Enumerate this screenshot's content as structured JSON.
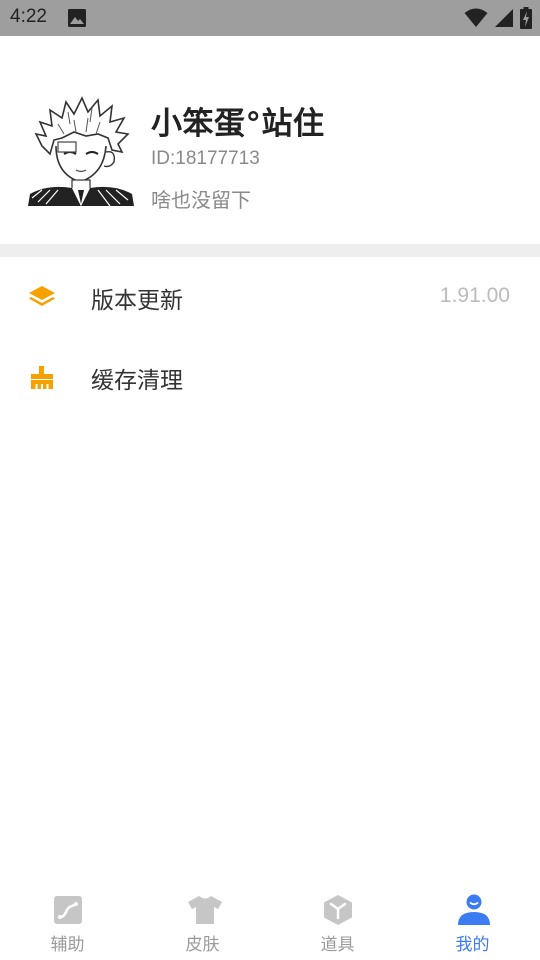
{
  "status_bar": {
    "time": "4:22",
    "icons": [
      "image-icon",
      "wifi-icon",
      "signal-icon",
      "battery-charging-icon"
    ]
  },
  "profile": {
    "nickname": "小笨蛋°站住",
    "id_text": "ID:18177713",
    "bio": "啥也没留下"
  },
  "menu": {
    "items": [
      {
        "label": "版本更新",
        "value": "1.91.00",
        "icon": "layers-icon"
      },
      {
        "label": "缓存清理",
        "value": "",
        "icon": "broom-icon"
      }
    ]
  },
  "tabbar": {
    "tabs": [
      {
        "label": "辅助",
        "icon": "assist-icon",
        "active": false
      },
      {
        "label": "皮肤",
        "icon": "tshirt-icon",
        "active": false
      },
      {
        "label": "道具",
        "icon": "box-icon",
        "active": false
      },
      {
        "label": "我的",
        "icon": "user-icon",
        "active": true
      }
    ]
  },
  "colors": {
    "accent": "#3b7cf2",
    "menu_icon": "#f5a100",
    "tab_inactive": "#c6c6c6",
    "status_bar": "#9e9e9e"
  }
}
